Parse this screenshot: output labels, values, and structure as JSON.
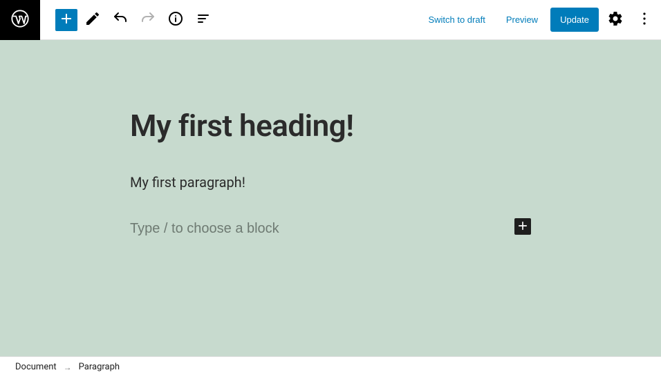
{
  "toolbar": {
    "switch_to_draft": "Switch to draft",
    "preview": "Preview",
    "update": "Update"
  },
  "editor": {
    "title": "My first heading!",
    "paragraph": "My first paragraph!",
    "block_placeholder": "Type / to choose a block"
  },
  "breadcrumb": {
    "root": "Document",
    "current": "Paragraph"
  }
}
